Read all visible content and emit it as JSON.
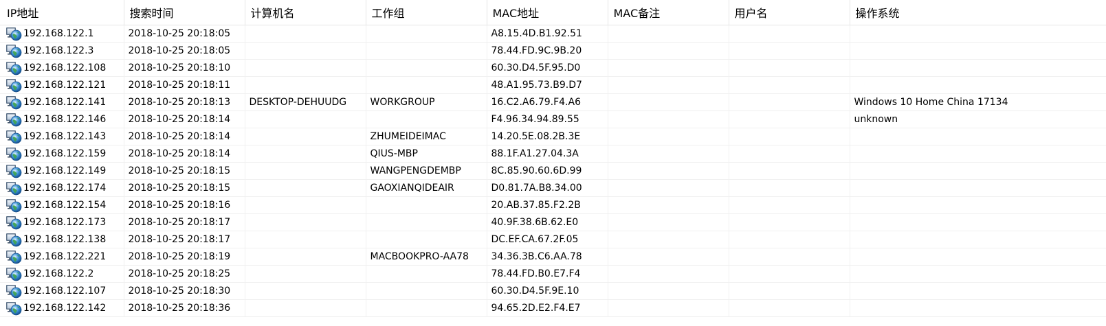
{
  "columns": [
    "IP地址",
    "搜索时间",
    "计算机名",
    "工作组",
    "MAC地址",
    "MAC备注",
    "用户名",
    "操作系统"
  ],
  "row_icon": "networked-computer-globe-icon",
  "rows": [
    [
      "192.168.122.1",
      "2018-10-25 20:18:05",
      "",
      "",
      "A8.15.4D.B1.92.51",
      "",
      "",
      ""
    ],
    [
      "192.168.122.3",
      "2018-10-25 20:18:05",
      "",
      "",
      "78.44.FD.9C.9B.20",
      "",
      "",
      ""
    ],
    [
      "192.168.122.108",
      "2018-10-25 20:18:10",
      "",
      "",
      "60.30.D4.5F.95.D0",
      "",
      "",
      ""
    ],
    [
      "192.168.122.121",
      "2018-10-25 20:18:11",
      "",
      "",
      "48.A1.95.73.B9.D7",
      "",
      "",
      ""
    ],
    [
      "192.168.122.141",
      "2018-10-25 20:18:13",
      "DESKTOP-DEHUUDG",
      "WORKGROUP",
      "16.C2.A6.79.F4.A6",
      "",
      "",
      "Windows 10 Home China 17134"
    ],
    [
      "192.168.122.146",
      "2018-10-25 20:18:14",
      "",
      "",
      "F4.96.34.94.89.55",
      "",
      "",
      "unknown"
    ],
    [
      "192.168.122.143",
      "2018-10-25 20:18:14",
      "",
      "ZHUMEIDEIMAC",
      "14.20.5E.08.2B.3E",
      "",
      "",
      ""
    ],
    [
      "192.168.122.159",
      "2018-10-25 20:18:14",
      "",
      "QIUS-MBP",
      "88.1F.A1.27.04.3A",
      "",
      "",
      ""
    ],
    [
      "192.168.122.149",
      "2018-10-25 20:18:15",
      "",
      "WANGPENGDEMBP",
      "8C.85.90.60.6D.99",
      "",
      "",
      ""
    ],
    [
      "192.168.122.174",
      "2018-10-25 20:18:15",
      "",
      "GAOXIANQIDEAIR",
      "D0.81.7A.B8.34.00",
      "",
      "",
      ""
    ],
    [
      "192.168.122.154",
      "2018-10-25 20:18:16",
      "",
      "",
      "20.AB.37.85.F2.2B",
      "",
      "",
      ""
    ],
    [
      "192.168.122.173",
      "2018-10-25 20:18:17",
      "",
      "",
      "40.9F.38.6B.62.E0",
      "",
      "",
      ""
    ],
    [
      "192.168.122.138",
      "2018-10-25 20:18:17",
      "",
      "",
      "DC.EF.CA.67.2F.05",
      "",
      "",
      ""
    ],
    [
      "192.168.122.221",
      "2018-10-25 20:18:19",
      "",
      "MACBOOKPRO-AA78",
      "34.36.3B.C6.AA.78",
      "",
      "",
      ""
    ],
    [
      "192.168.122.2",
      "2018-10-25 20:18:25",
      "",
      "",
      "78.44.FD.B0.E7.F4",
      "",
      "",
      ""
    ],
    [
      "192.168.122.107",
      "2018-10-25 20:18:30",
      "",
      "",
      "60.30.D4.5F.9E.10",
      "",
      "",
      ""
    ],
    [
      "192.168.122.142",
      "2018-10-25 20:18:36",
      "",
      "",
      "94.65.2D.E2.F4.E7",
      "",
      "",
      ""
    ]
  ]
}
